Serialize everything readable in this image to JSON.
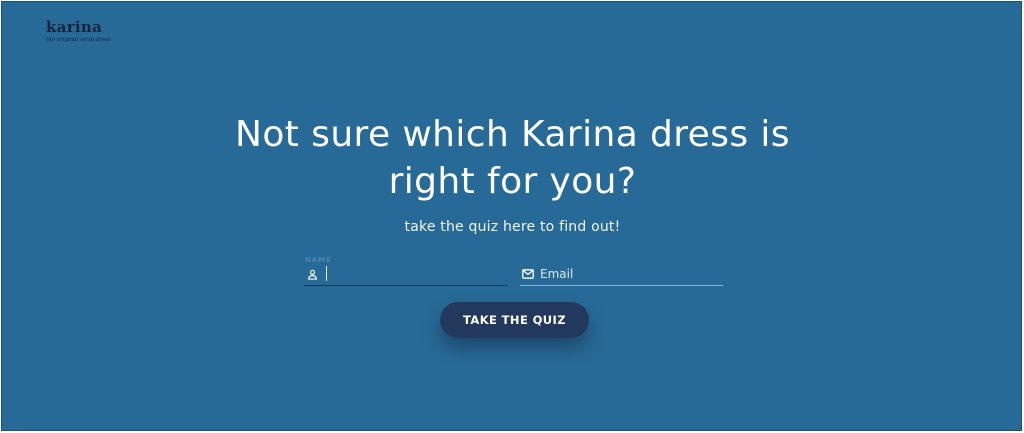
{
  "brand": {
    "name": "karina",
    "tagline": "the original wrap dress"
  },
  "hero": {
    "headline_line1": "Not sure which Karina dress is",
    "headline_line2": "right for you?",
    "subheadline": "take the quiz here to find out!"
  },
  "form": {
    "name_field": {
      "label": "NAME",
      "value": "",
      "icon": "user-icon"
    },
    "email_field": {
      "placeholder": "Email",
      "value": "",
      "icon": "mail-icon"
    },
    "submit_label": "TAKE THE QUIZ"
  },
  "colors": {
    "background": "#286a97",
    "button": "#22385c",
    "logo": "#16243a",
    "text": "#ffffff"
  }
}
